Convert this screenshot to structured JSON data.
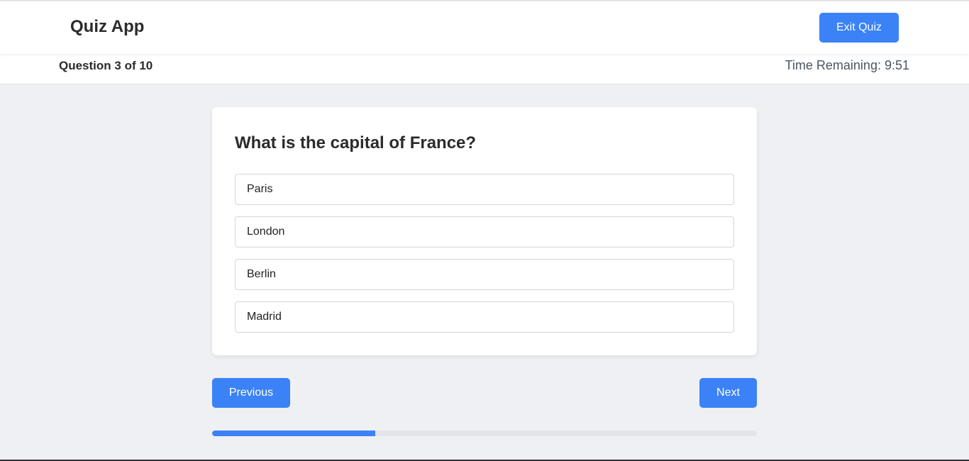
{
  "header": {
    "app_title": "Quiz App",
    "exit_label": "Exit Quiz"
  },
  "status": {
    "question_counter": "Question 3 of 10",
    "time_remaining": "Time Remaining: 9:51"
  },
  "question": {
    "text": "What is the capital of France?",
    "options": [
      "Paris",
      "London",
      "Berlin",
      "Madrid"
    ]
  },
  "navigation": {
    "previous_label": "Previous",
    "next_label": "Next"
  },
  "progress": {
    "fraction": 0.3
  },
  "colors": {
    "accent": "#3b82f6",
    "background": "#eef0f4"
  }
}
